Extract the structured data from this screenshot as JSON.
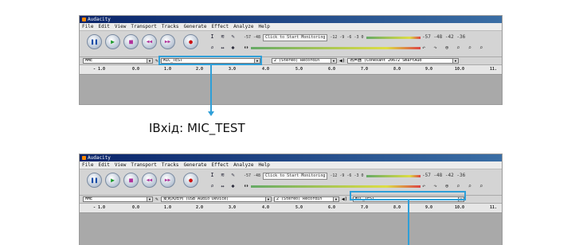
{
  "app_title": "Audacity",
  "menu": [
    "File",
    "Edit",
    "View",
    "Transport",
    "Tracks",
    "Generate",
    "Effect",
    "Analyze",
    "Help"
  ],
  "transport_icons": [
    "pause-icon",
    "play-icon",
    "stop-icon",
    "skip-start-icon",
    "skip-end-icon",
    "record-icon"
  ],
  "transport_glyphs": [
    "❚❚",
    "▶",
    "■",
    "◀◀",
    "▶▶",
    "●"
  ],
  "tools": [
    "I",
    "≋",
    "✎",
    "⌕",
    "↔",
    "✱"
  ],
  "meter": {
    "click_label": "Click to Start Monitoring",
    "left_ticks": "-57   -48",
    "right_ticks": "-12 -9 -6 -3 0",
    "right2": "-57   -48  -42  -36"
  },
  "right_icons": "↶ ↷  ⊕  ⌕ ⌕ ⌕",
  "colors": {
    "highlight": "#2f9fd8"
  },
  "top": {
    "host": "MME",
    "mic": "MIC_TEST",
    "channels": "2 (Stereo) Recordin",
    "speaker": "扬声器 (Conexant 20672 SmartAud"
  },
  "bottom": {
    "host": "MME",
    "mic": "麦克风阵列 (USB Audio Device)",
    "channels": "2 (Stereo) Recordin",
    "speaker": "MIC_TEST"
  },
  "ruler": [
    "- 1.0",
    "0.0",
    "1.0",
    "2.0",
    "3.0",
    "4.0",
    "5.0",
    "6.0",
    "7.0",
    "8.0",
    "9.0",
    "10.0",
    "11."
  ],
  "caption": "IВхід: MIC_TEST"
}
